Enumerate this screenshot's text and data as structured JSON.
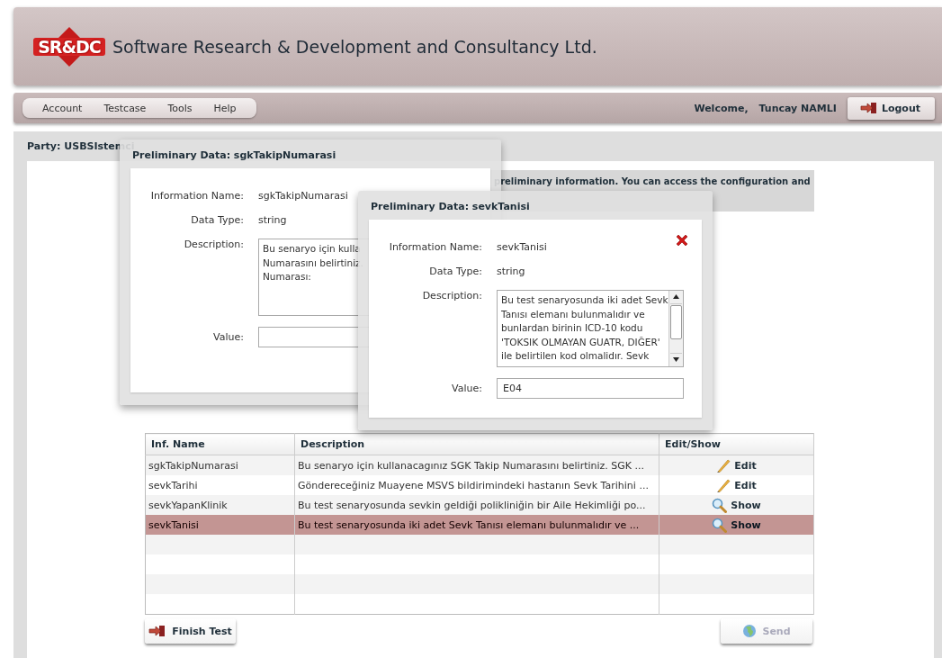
{
  "header": {
    "logo": "SR&DC",
    "title": "Software Research & Development and Consultancy Ltd."
  },
  "menu": [
    "Account",
    "Testcase",
    "Tools",
    "Help"
  ],
  "user": {
    "greeting": "Welcome,",
    "name": "Tuncay NAMLI",
    "logout": "Logout"
  },
  "party": "Party: USBSIstemci",
  "notice": [
    "preliminary information. You can access the configuration and"
  ],
  "dialogs": [
    {
      "title": "Preliminary Data: sgkTakipNumarasi",
      "closable": false,
      "fields": [
        {
          "kind": "text",
          "label": "Information Name:",
          "value": "sgkTakipNumarasi"
        },
        {
          "kind": "text",
          "label": "Data Type:",
          "value": "string"
        },
        {
          "kind": "textarea",
          "label": "Description:",
          "value": "Bu senaryo için kulla\nNumarasını belirtiniz.\nNumarası:"
        },
        {
          "kind": "input",
          "label": "Value:"
        }
      ]
    },
    {
      "title": "Preliminary Data: sevkTanisi",
      "closable": true,
      "fields": [
        {
          "kind": "text",
          "label": "Information Name:",
          "value": "sevkTanisi"
        },
        {
          "kind": "text",
          "label": "Data Type:",
          "value": "string"
        },
        {
          "kind": "textarea",
          "label": "Description:",
          "value": "Bu test senaryosunda iki adet Sevk\nTanısı elemanı bulunmalıdır ve\nbunlardan birinin ICD-10 kodu\n'TOKSIK OLMAYAN GUATR, DIĞER'\nile belirtilen kod olmalidır. Sevk"
        },
        {
          "kind": "input",
          "label": "Value:",
          "value": "E04"
        }
      ]
    }
  ],
  "table": {
    "columns": [
      "Inf. Name",
      "Description",
      "Edit/Show"
    ],
    "rows": [
      {
        "name": "sgkTakipNumarasi",
        "description": "Bu senaryo için kullanacagınız SGK Takip Numarasını belirtiniz. SGK ...",
        "action": {
          "kind": "edit",
          "label": "Edit"
        },
        "selected": false
      },
      {
        "name": "sevkTarihi",
        "description": "Göndereceğiniz Muayene MSVS bildirimindeki hastanın Sevk Tarihini ...",
        "action": {
          "kind": "edit",
          "label": "Edit"
        },
        "selected": false
      },
      {
        "name": "sevkYapanKlinik",
        "description": "Bu test senaryosunda sevkin geldiği polikliniğin bir Aile Hekimliği po...",
        "action": {
          "kind": "show",
          "label": "Show"
        },
        "selected": false
      },
      {
        "name": "sevkTanisi",
        "description": "Bu test senaryosunda iki adet Sevk Tanısı elemanı bulunmalıdır ve ...",
        "action": {
          "kind": "show",
          "label": "Show"
        },
        "selected": true
      }
    ]
  },
  "buttons": [
    {
      "kind": "finish",
      "label": "Finish Test",
      "disabled": false
    },
    {
      "kind": "send",
      "label": "Send",
      "disabled": true
    }
  ]
}
